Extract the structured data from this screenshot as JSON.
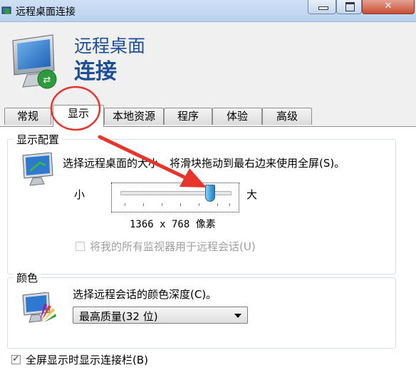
{
  "window": {
    "title": "远程桌面连接"
  },
  "header": {
    "line1": "远程桌面",
    "line2": "连接"
  },
  "tabs": [
    {
      "label": "常规",
      "active": false
    },
    {
      "label": "显示",
      "active": true
    },
    {
      "label": "本地资源",
      "active": false
    },
    {
      "label": "程序",
      "active": false
    },
    {
      "label": "体验",
      "active": false
    },
    {
      "label": "高级",
      "active": false
    }
  ],
  "display_config": {
    "group_label": "显示配置",
    "description": "选择远程桌面的大小。将滑块拖动到最右边来使用全屏(S)。",
    "slider_small_label": "小",
    "slider_large_label": "大",
    "slider_value_fraction": 0.82,
    "resolution": "1366 x 768 像素",
    "multi_monitor_label": "将我的所有监视器用于远程会话(U)",
    "multi_monitor_checked": false,
    "multi_monitor_enabled": false
  },
  "colors": {
    "group_label": "颜色",
    "description": "选择远程会话的颜色深度(C)。",
    "selected": "最高质量(32 位)"
  },
  "fullscreen_bar": {
    "label": "全屏显示时显示连接栏(B)",
    "checked": true
  },
  "annotation_color": "#e8352b"
}
